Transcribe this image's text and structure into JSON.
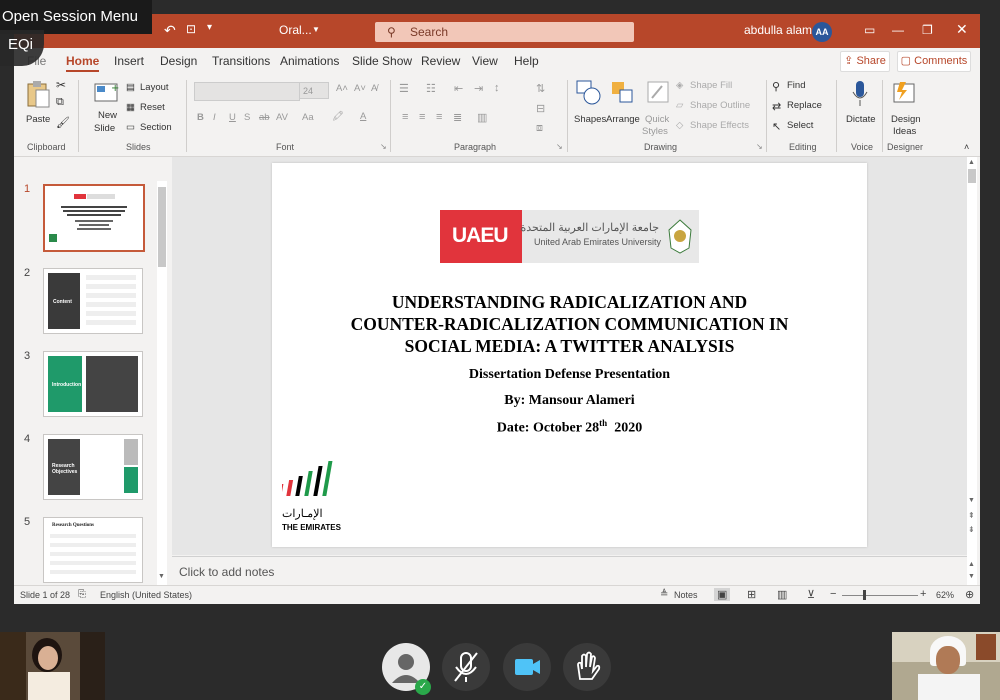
{
  "meeting": {
    "menu_label": "Open Session Menu",
    "logo_text": "EQi"
  },
  "titlebar": {
    "doc_name": "Oral...",
    "search_placeholder": "Search",
    "user_name": "abdulla alameri",
    "user_initials": "AA",
    "accent": "#b7472a"
  },
  "tabs": {
    "file": "File",
    "items": [
      "Home",
      "Insert",
      "Design",
      "Transitions",
      "Animations",
      "Slide Show",
      "Review",
      "View",
      "Help"
    ],
    "active": "Home",
    "share": "Share",
    "comments": "Comments"
  },
  "ribbon": {
    "clipboard": {
      "label": "Clipboard",
      "paste": "Paste"
    },
    "slides": {
      "label": "Slides",
      "new_slide_1": "New",
      "new_slide_2": "Slide",
      "layout": "Layout",
      "reset": "Reset",
      "section": "Section"
    },
    "font": {
      "label": "Font",
      "size": "24",
      "bold": "B",
      "italic": "I",
      "underline": "U",
      "shadow": "S",
      "strike": "ab",
      "spacing": "AV",
      "case": "Aa"
    },
    "paragraph": {
      "label": "Paragraph"
    },
    "drawing": {
      "label": "Drawing",
      "shapes": "Shapes",
      "arrange": "Arrange",
      "quick_styles_1": "Quick",
      "quick_styles_2": "Styles",
      "shape_fill": "Shape Fill",
      "shape_outline": "Shape Outline",
      "shape_effects": "Shape Effects"
    },
    "editing": {
      "label": "Editing",
      "find": "Find",
      "replace": "Replace",
      "select": "Select"
    },
    "voice": {
      "label": "Voice",
      "dictate": "Dictate"
    },
    "designer": {
      "label": "Designer",
      "design_ideas_1": "Design",
      "design_ideas_2": "Ideas"
    }
  },
  "thumbnails": [
    {
      "num": "1",
      "title": ""
    },
    {
      "num": "2",
      "title": "Content"
    },
    {
      "num": "3",
      "title": "Introduction"
    },
    {
      "num": "4",
      "title": "Research Objectives"
    },
    {
      "num": "5",
      "title": "Research Questions"
    }
  ],
  "slide": {
    "uaeu_logo": "UAEU",
    "university_ar": "جامعة الإمارات العربية المتحدة",
    "university_en": "United Arab Emirates University",
    "title_line1": "UNDERSTANDING RADICALIZATION AND",
    "title_line2": "COUNTER-RADICALIZATION COMMUNICATION IN",
    "title_line3": "SOCIAL MEDIA: A TWITTER ANALYSIS",
    "subtitle": "Dissertation Defense Presentation",
    "author": "By: Mansour Alameri",
    "date_prefix": "Date: October 28",
    "date_sup": "th",
    "date_suffix": "2020",
    "emirates_ar": "الإمـارات",
    "emirates_en": "THE EMIRATES",
    "brand_red": "#e1343c"
  },
  "notes_placeholder": "Click to add notes",
  "status": {
    "slide_info": "Slide 1 of 28",
    "language": "English (United States)",
    "notes": "Notes",
    "zoom": "62%"
  }
}
